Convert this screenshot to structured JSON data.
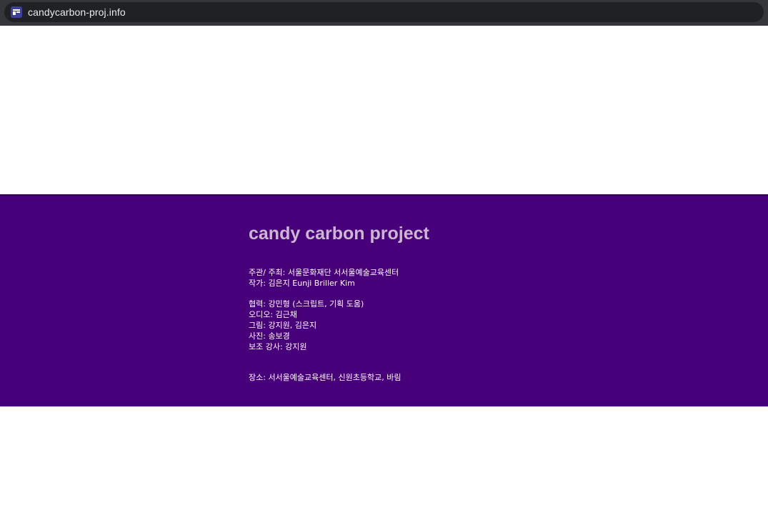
{
  "browser": {
    "url": "candycarbon-proj.info",
    "favicon": "site-layout-icon"
  },
  "colors": {
    "band_background": "#47007a",
    "title_color": "#cbb8cf",
    "text_color": "#ffffff"
  },
  "project": {
    "title": "candy carbon project",
    "credits_1": [
      "주관/ 주최: 서울문화재단 서서울예술교육센터",
      "작가: 김은지 Eunji Briller Kim"
    ],
    "credits_2": [
      "협력: 강민형 (스크립트, 기획 도움)",
      "오디오: 김근채",
      "그림: 강지원, 김은지",
      "사진: 송보경",
      "보조 강사: 강지원"
    ],
    "venue": "장소: 서서울예술교육센터, 신원초등학교, 바림"
  }
}
